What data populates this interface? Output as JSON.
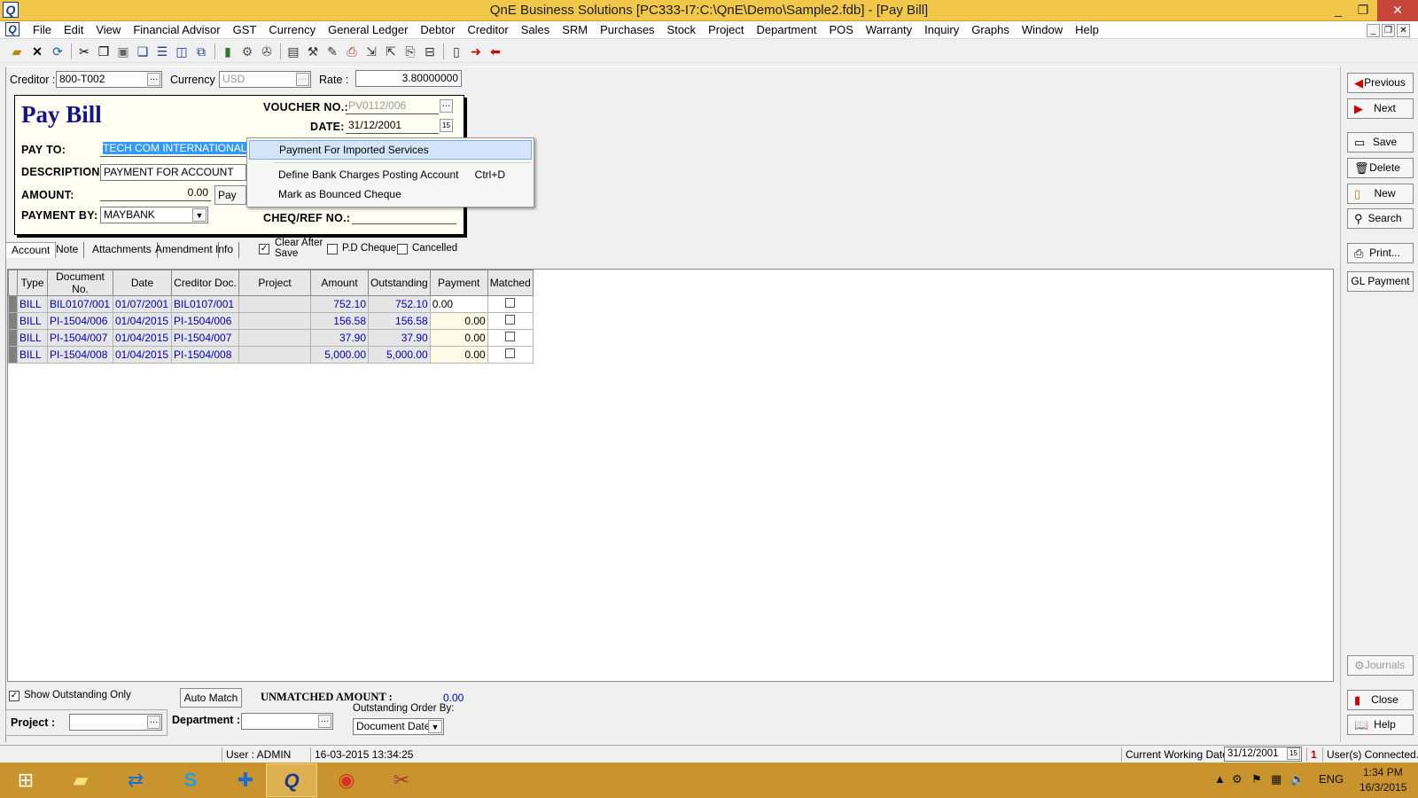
{
  "window": {
    "title": "QnE Business Solutions [PC333-I7:C:\\QnE\\Demo\\Sample2.fdb] - [Pay Bill]",
    "app_icon": "Q",
    "controls": [
      "_",
      "❐",
      "✕"
    ]
  },
  "menubar": {
    "items": [
      "File",
      "Edit",
      "View",
      "Financial Advisor",
      "GST",
      "Currency",
      "General Ledger",
      "Debtor",
      "Creditor",
      "Sales",
      "SRM",
      "Purchases",
      "Stock",
      "Project",
      "Department",
      "POS",
      "Warranty",
      "Inquiry",
      "Graphs",
      "Window",
      "Help"
    ],
    "mdi_controls": [
      "_",
      "❐",
      "✕"
    ]
  },
  "header": {
    "creditor_label": "Creditor :",
    "creditor_value": "800-T002",
    "currency_label": "Currency :",
    "currency_value": "USD",
    "rate_label": "Rate :",
    "rate_value": "3.80000000"
  },
  "paybill": {
    "title": "Pay Bill",
    "voucher_label": "VOUCHER NO.:",
    "voucher_value": "PV0112/006",
    "date_label": "DATE:",
    "date_value": "31/12/2001",
    "payto_label": "PAY TO:",
    "payto_value": "TECH COM INTERNATIONAL",
    "description_label": "DESCRIPTION:",
    "description_value": "PAYMENT FOR ACCOUNT",
    "amount_label": "AMOUNT:",
    "amount_value": "0.00",
    "pay_all_label": "Pay Al",
    "paymentby_label": "PAYMENT BY:",
    "paymentby_value": "MAYBANK",
    "cheq_label": "CHEQ/REF NO.:",
    "cheq_value": ""
  },
  "context_menu": {
    "items": [
      {
        "label": "Payment For Imported Services",
        "shortcut": ""
      },
      {
        "label": "Define Bank Charges Posting Account",
        "shortcut": "Ctrl+D"
      },
      {
        "label": "Mark as Bounced Cheque",
        "shortcut": ""
      }
    ]
  },
  "tabs": [
    "Account",
    "Note",
    "Attachments",
    "Amendment",
    "Info"
  ],
  "options": {
    "clear_after_save_line1": "Clear After",
    "clear_after_save_line2": "Save",
    "pd_cheque": "P.D Cheque",
    "cancelled": "Cancelled"
  },
  "grid": {
    "columns": [
      "Type",
      "Document No.",
      "Date",
      "Creditor Doc.",
      "Project",
      "Amount",
      "Outstanding",
      "Payment",
      "Matched"
    ],
    "rows": [
      {
        "type": "BILL",
        "doc": "BIL0107/001",
        "date": "01/07/2001",
        "cdoc": "BIL0107/001",
        "project": "",
        "amount": "752.10",
        "outstanding": "752.10",
        "payment": "0.00"
      },
      {
        "type": "BILL",
        "doc": "PI-1504/006",
        "date": "01/04/2015",
        "cdoc": "PI-1504/006",
        "project": "",
        "amount": "156.58",
        "outstanding": "156.58",
        "payment": "0.00"
      },
      {
        "type": "BILL",
        "doc": "PI-1504/007",
        "date": "01/04/2015",
        "cdoc": "PI-1504/007",
        "project": "",
        "amount": "37.90",
        "outstanding": "37.90",
        "payment": "0.00"
      },
      {
        "type": "BILL",
        "doc": "PI-1504/008",
        "date": "01/04/2015",
        "cdoc": "PI-1504/008",
        "project": "",
        "amount": "5,000.00",
        "outstanding": "5,000.00",
        "payment": "0.00"
      }
    ]
  },
  "bottom": {
    "show_outstanding_only": "Show Outstanding Only",
    "auto_match": "Auto Match",
    "unmatched_label": "UNMATCHED AMOUNT :",
    "unmatched_value": "0.00",
    "project_label": "Project :",
    "department_label": "Department :",
    "order_by_label": "Outstanding Order By:",
    "order_by_value": "Document Date"
  },
  "right_buttons": {
    "previous": "Previous",
    "next": "Next",
    "save": "Save",
    "delete": "Delete",
    "new": "New",
    "search": "Search",
    "print": "Print...",
    "gl_payment": "GL Payment",
    "journals": "Journals",
    "close": "Close",
    "help": "Help"
  },
  "statusbar": {
    "user": "User : ADMIN",
    "datetime": "16-03-2015 13:34:25",
    "working_date_label": "Current Working Date :",
    "working_date_value": "31/12/2001",
    "users_count": "1",
    "users_label": "User(s) Connected."
  },
  "taskbar": {
    "language": "ENG",
    "time": "1:34 PM",
    "date": "16/3/2015"
  },
  "colors": {
    "titlebar": "#f1c84a",
    "taskbar": "#c9942d",
    "grid_text": "#0000c8",
    "paybill_title": "#14148a",
    "selection": "#3399ff"
  }
}
